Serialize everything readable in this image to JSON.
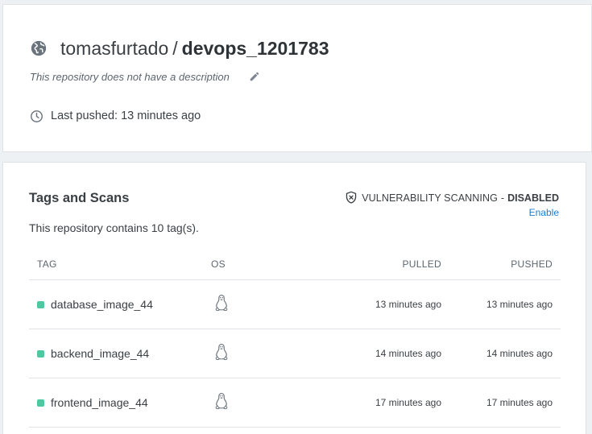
{
  "repo": {
    "owner": "tomasfurtado",
    "separator": "/",
    "name": "devops_1201783",
    "description": "This repository does not have a description",
    "last_pushed": "Last pushed: 13 minutes ago"
  },
  "icons": {
    "visibility": "globe-icon",
    "edit": "pencil-icon",
    "time": "clock-icon",
    "scan": "shield-x-icon",
    "os": "linux-tux-icon"
  },
  "tags_section": {
    "title": "Tags and Scans",
    "scan_label": "VULNERABILITY SCANNING",
    "scan_separator": "-",
    "scan_state": "DISABLED",
    "enable_label": "Enable",
    "tag_count_text": "This repository contains 10 tag(s).",
    "columns": {
      "tag": "TAG",
      "os": "OS",
      "pulled": "PULLED",
      "pushed": "PUSHED"
    },
    "rows": [
      {
        "tag": "database_image_44",
        "pulled": "13 minutes ago",
        "pushed": "13 minutes ago"
      },
      {
        "tag": "backend_image_44",
        "pulled": "14 minutes ago",
        "pushed": "14 minutes ago"
      },
      {
        "tag": "frontend_image_44",
        "pulled": "17 minutes ago",
        "pushed": "17 minutes ago"
      }
    ]
  },
  "colors": {
    "status_dot": "#4cc9a0",
    "link": "#1a7ed1",
    "icon": "#7b858f"
  }
}
